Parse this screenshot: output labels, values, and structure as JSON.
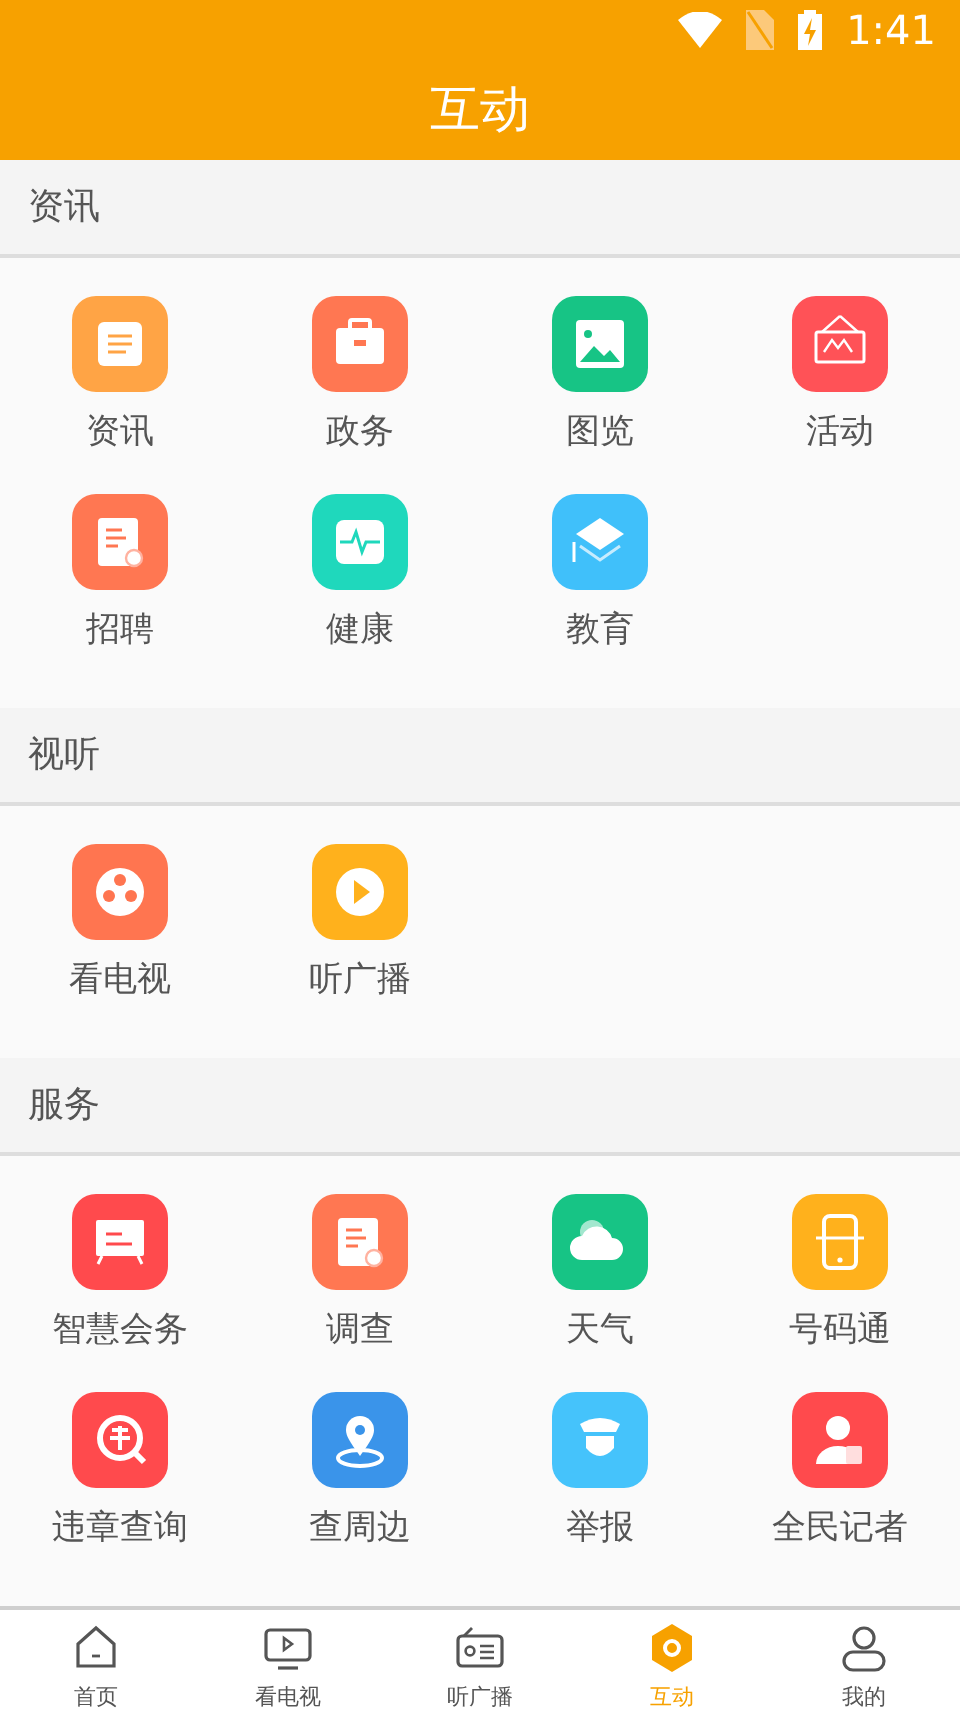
{
  "status_bar": {
    "time": "1:41"
  },
  "header": {
    "title": "互动"
  },
  "sections": [
    {
      "title": "资讯",
      "items": [
        {
          "label": "资讯",
          "color": "#ffa445"
        },
        {
          "label": "政务",
          "color": "#ff7752"
        },
        {
          "label": "图览",
          "color": "#17c485"
        },
        {
          "label": "活动",
          "color": "#ff5257"
        },
        {
          "label": "招聘",
          "color": "#ff7752"
        },
        {
          "label": "健康",
          "color": "#1fd8bc"
        },
        {
          "label": "教育",
          "color": "#40c0fa"
        }
      ]
    },
    {
      "title": "视听",
      "items": [
        {
          "label": "看电视",
          "color": "#ff7550"
        },
        {
          "label": "听广播",
          "color": "#ffb11c"
        }
      ]
    },
    {
      "title": "服务",
      "items": [
        {
          "label": "智慧会务",
          "color": "#ff4a4d"
        },
        {
          "label": "调查",
          "color": "#ff7752"
        },
        {
          "label": "天气",
          "color": "#17c485"
        },
        {
          "label": "号码通",
          "color": "#ffb11c"
        },
        {
          "label": "违章查询",
          "color": "#ff4a4d"
        },
        {
          "label": "查周边",
          "color": "#3a94ea"
        },
        {
          "label": "举报",
          "color": "#45c3fb"
        },
        {
          "label": "全民记者",
          "color": "#ff4a4d"
        }
      ]
    }
  ],
  "tabs": [
    {
      "label": "首页",
      "selected": false
    },
    {
      "label": "看电视",
      "selected": false
    },
    {
      "label": "听广播",
      "selected": false
    },
    {
      "label": "互动",
      "selected": true
    },
    {
      "label": "我的",
      "selected": false
    }
  ]
}
